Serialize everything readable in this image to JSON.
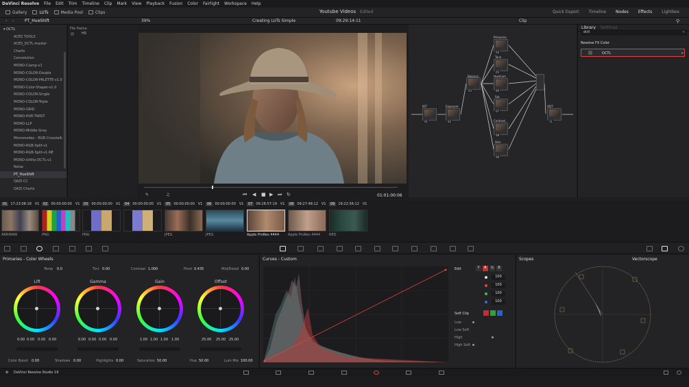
{
  "menu": [
    "DaVinci Resolve",
    "File",
    "Edit",
    "Trim",
    "Timeline",
    "Clip",
    "Mark",
    "View",
    "Playback",
    "Fusion",
    "Color",
    "Fairlight",
    "Workspace",
    "Help"
  ],
  "toolbar": {
    "left": [
      "Gallery",
      "LUTs",
      "Media Pool",
      "Clips"
    ],
    "project_title": "Youtube Videos",
    "project_status": "Edited",
    "right": [
      "Quick Export",
      "Timeline",
      "Nodes",
      "Effects",
      "Lightbox"
    ]
  },
  "viewer_bar": {
    "panel_title": "PT_HueShift",
    "zoom": "39%",
    "clip_name": "Creating LUTs Simple",
    "timecode": "09:29:14:11",
    "mode": "Clip"
  },
  "lut_library": {
    "header": "DCTL",
    "items": [
      "ACES TOOLS",
      "ACES_DCTL-master",
      "Charts",
      "Convolution",
      "MONO-Clamp-v1",
      "MONO-COLOR-Double",
      "MONO-COLOR-PALETTE-v1.0",
      "MONO-Color-Shaper-v1.0",
      "MONO-COLOR-Single",
      "MONO-COLOR-Triple",
      "MONO-GRID",
      "MONO-HUE-TWIST",
      "MONO-LLP",
      "MONO-Middle-Gray",
      "Monomodes - RGB Crosstalk ...",
      "MONO-RGB-Split-v1",
      "MONO-RGB-Split-v1-NE",
      "MONO-Utility-DCTL-v1",
      "Noise",
      "PT_HueShift",
      "QAZI CC",
      "QAZI Charts"
    ],
    "selected": "PT_HueShift",
    "file_header": "File Name",
    "file_items": [
      "HS"
    ]
  },
  "transport": {
    "timecode": "01:01:00:06"
  },
  "nodes": [
    {
      "label": "IDT",
      "num": "01"
    },
    {
      "label": "Exposure",
      "num": "02"
    },
    {
      "label": "Balance",
      "num": "03"
    },
    {
      "label": "Primaries",
      "num": "04"
    },
    {
      "label": "Tone",
      "num": "05"
    },
    {
      "label": "Hue/Lum",
      "num": "06"
    },
    {
      "label": "Sat",
      "num": "07"
    },
    {
      "label": "Contrast",
      "num": "08"
    },
    {
      "label": "Skin",
      "num": "09"
    },
    {
      "label": "ODT",
      "num": "11"
    }
  ],
  "fx_panel": {
    "tabs": [
      "Library",
      "Settings"
    ],
    "search": "dctl",
    "section": "Resolve FX Color",
    "item": "DCTL"
  },
  "clips": [
    {
      "num": "01",
      "tc": "17:23:08:18",
      "track": "V1",
      "fmt": "ARRIRAW"
    },
    {
      "num": "02",
      "tc": "00:00:00:00",
      "track": "V1",
      "fmt": "PNG"
    },
    {
      "num": "03",
      "tc": "00:00:00:00",
      "track": "V1",
      "fmt": "PNG"
    },
    {
      "num": "04",
      "tc": "00:00:00:00",
      "track": "V1",
      "fmt": "JPEG"
    },
    {
      "num": "05",
      "tc": "00:00:00:00",
      "track": "V1",
      "fmt": "JPEG"
    },
    {
      "num": "06",
      "tc": "00:00:00:00",
      "track": "V1",
      "fmt": "Apple ProRes 4444"
    },
    {
      "num": "07",
      "tc": "09:28:57:19",
      "track": "V1",
      "fmt": "Apple ProRes 4444"
    },
    {
      "num": "08",
      "tc": "09:27:48:12",
      "track": "V1",
      "fmt": "RED"
    },
    {
      "num": "09",
      "tc": "19:22:56:12",
      "track": "V1",
      "fmt": ""
    }
  ],
  "color_wheels": {
    "title": "Primaries - Color Wheels",
    "temp_label": "Temp",
    "temp": "0.0",
    "tint_label": "Tint",
    "tint": "0.00",
    "contrast_label": "Contrast",
    "contrast": "1.000",
    "pivot_label": "Pivot",
    "pivot": "0.435",
    "middetail_label": "Mid/Detail",
    "middetail": "0.00",
    "wheels": [
      {
        "name": "Lift",
        "values": [
          "0.00",
          "0.00",
          "0.00",
          "0.00"
        ]
      },
      {
        "name": "Gamma",
        "values": [
          "0.00",
          "0.00",
          "0.00",
          "0.00"
        ]
      },
      {
        "name": "Gain",
        "values": [
          "1.00",
          "1.00",
          "1.00",
          "1.00"
        ]
      },
      {
        "name": "Offset",
        "values": [
          "25.00",
          "25.00",
          "25.00"
        ]
      }
    ],
    "colorboost_label": "Color Boost",
    "colorboost": "0.00",
    "shadows_label": "Shadows",
    "shadows": "0.00",
    "highlights_label": "Highlights",
    "highlights": "0.00",
    "saturation_label": "Saturation",
    "saturation": "50.00",
    "hue_label": "Hue",
    "hue": "50.00",
    "lummix_label": "Lum Mix",
    "lummix": "100.00"
  },
  "curves": {
    "title": "Curves - Custom",
    "edit_label": "Edit",
    "channels": [
      "Y",
      "R",
      "G",
      "B"
    ],
    "values": [
      "100",
      "100",
      "100",
      "100"
    ],
    "softclip_label": "Soft Clip",
    "softclip_rows": [
      "Low",
      "Low Soft",
      "High",
      "High Soft"
    ]
  },
  "scopes": {
    "title": "Scopes",
    "mode": "Vectorscope"
  },
  "bottom": {
    "app_name": "DaVinci Resolve Studio 19"
  },
  "colors": {
    "accent": "#e0443e",
    "bg": "#1e1e20",
    "text": "#9a9a9e"
  }
}
